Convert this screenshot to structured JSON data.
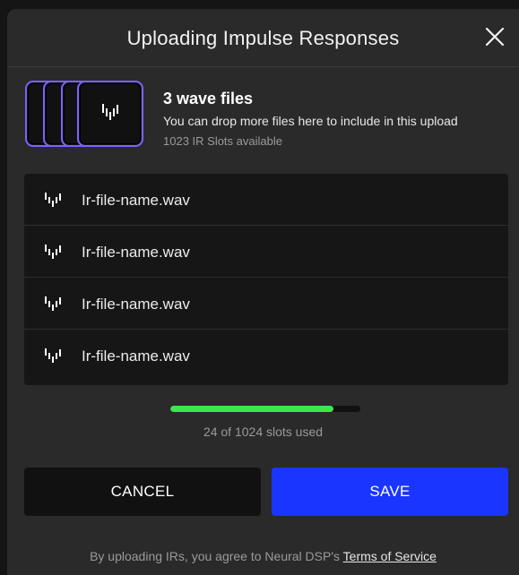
{
  "modal": {
    "title": "Uploading Impulse Responses",
    "close_icon": "close-icon"
  },
  "drop_zone": {
    "files_count": "3 wave files",
    "hint": "You can drop more files here to include in this upload",
    "slots_available": "1023 IR Slots available",
    "card_icon": "waveform-icon",
    "accent_color": "#7b63ff"
  },
  "files": [
    {
      "name": "Ir-file-name.wav",
      "icon": "waveform-icon"
    },
    {
      "name": "Ir-file-name.wav",
      "icon": "waveform-icon"
    },
    {
      "name": "Ir-file-name.wav",
      "icon": "waveform-icon"
    },
    {
      "name": "Ir-file-name.wav",
      "icon": "waveform-icon"
    }
  ],
  "usage": {
    "used": 24,
    "total": 1024,
    "fill_fraction": 0.86,
    "label": "24 of 1024 slots used",
    "bar_color": "#3ae84d"
  },
  "actions": {
    "cancel_label": "CANCEL",
    "save_label": "SAVE",
    "save_color": "#1a35ff"
  },
  "footer": {
    "text": "By uploading IRs, you agree to Neural DSP's ",
    "link_text": "Terms of Service"
  }
}
